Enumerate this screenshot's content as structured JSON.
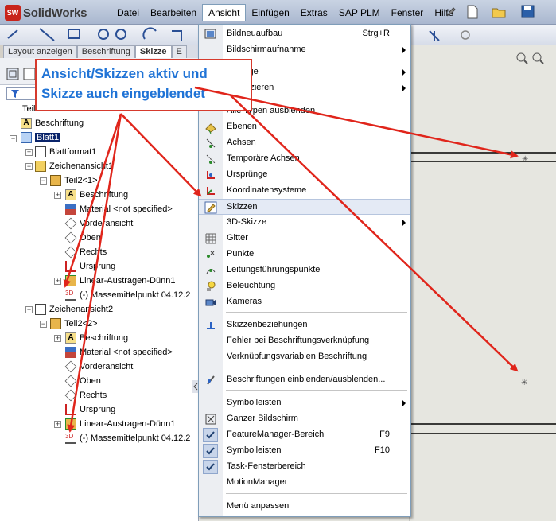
{
  "app": {
    "name": "SolidWorks",
    "badge": "SW"
  },
  "menubar": {
    "items": [
      "Datei",
      "Bearbeiten",
      "Ansicht",
      "Einfügen",
      "Extras",
      "SAP PLM",
      "Fenster",
      "Hilfe"
    ],
    "active": "Ansicht"
  },
  "tabs": [
    "Layout anzeigen",
    "Beschriftung",
    "Skizze",
    "E"
  ],
  "tabs_selected": "Skizze",
  "tree": {
    "root": "Teil2",
    "beschriftung": "Beschriftung",
    "blatt": "Blatt1",
    "blattformat": "Blattformat1",
    "view1": "Zeichenansicht1",
    "view1_part": "Teil2<1>",
    "view2": "Zeichenansicht2",
    "view2_part": "Teil2<2>",
    "items": {
      "beschriftung": "Beschriftung",
      "material": "Material <not specified>",
      "vorder": "Vorderansicht",
      "oben": "Oben",
      "rechts": "Rechts",
      "ursprung": "Ursprung",
      "feature": "Linear-Austragen-Dünn1",
      "mass": "(-) Massemittelpunkt 04.12.2"
    }
  },
  "callout": {
    "line1": "Ansicht/Skizzen aktiv und",
    "line2": "Skizze auch eingeblendet"
  },
  "dropdown": {
    "bildneuaufbau": "Bildneuaufbau",
    "bildneuaufbau_sc": "Strg+R",
    "bildschirmaufnahme": "Bildschirmaufnahme",
    "anzeige": "Anzeige",
    "modifizieren": "Modifizieren",
    "alle_typen": "Alle Typen ausblenden",
    "ebenen": "Ebenen",
    "achsen": "Achsen",
    "temp_achsen": "Temporäre Achsen",
    "urspruenge": "Ursprünge",
    "koordinatensysteme": "Koordinatensysteme",
    "skizzen": "Skizzen",
    "skizze3d": "3D-Skizze",
    "gitter": "Gitter",
    "punkte": "Punkte",
    "leitung": "Leitungsführungspunkte",
    "beleuchtung": "Beleuchtung",
    "kameras": "Kameras",
    "skizzenbeziehungen": "Skizzenbeziehungen",
    "fehler": "Fehler bei Beschriftungsverknüpfung",
    "verknuepfung": "Verknüpfungsvariablen Beschriftung",
    "beschriftungen": "Beschriftungen einblenden/ausblenden...",
    "symbolleisten": "Symbolleisten",
    "ganzer": "Ganzer Bildschirm",
    "featuremanager": "FeatureManager-Bereich",
    "featuremanager_sc": "F9",
    "symbolleisten2": "Symbolleisten",
    "symbolleisten2_sc": "F10",
    "task": "Task-Fensterbereich",
    "motion": "MotionManager",
    "menu_anpassen": "Menü anpassen"
  },
  "colors": {
    "callout_text": "#1f73d6",
    "callout_border": "#d63a2d",
    "arrow": "#e0251b",
    "selection": "#0a246a"
  }
}
